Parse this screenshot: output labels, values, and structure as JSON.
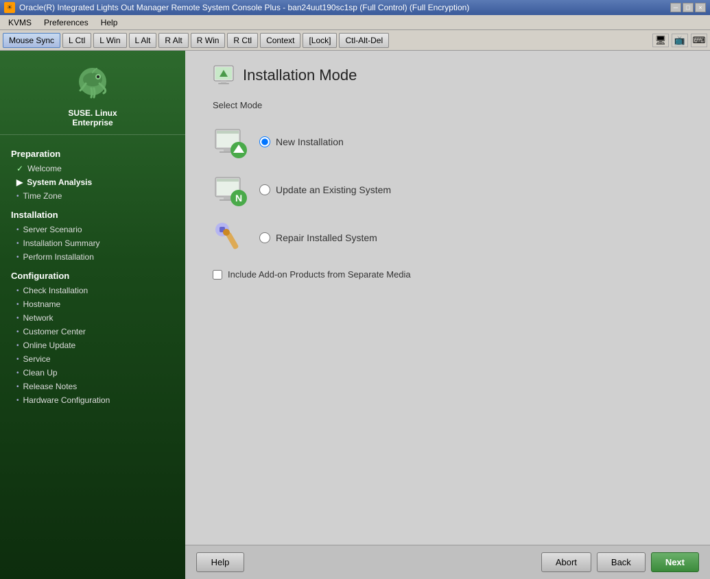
{
  "titlebar": {
    "icon": "☀",
    "title": "Oracle(R) Integrated Lights Out Manager Remote System Console Plus - ban24uut190sc1sp (Full Control) (Full Encryption)",
    "minimize": "─",
    "maximize": "□",
    "close": "×"
  },
  "menubar": {
    "items": [
      "KVMS",
      "Preferences",
      "Help"
    ]
  },
  "toolbar": {
    "buttons": [
      {
        "label": "Mouse Sync",
        "active": true
      },
      {
        "label": "L Ctl",
        "active": false
      },
      {
        "label": "L Win",
        "active": false
      },
      {
        "label": "L Alt",
        "active": false
      },
      {
        "label": "R Alt",
        "active": false
      },
      {
        "label": "R Win",
        "active": false
      },
      {
        "label": "R Ctl",
        "active": false
      },
      {
        "label": "Context",
        "active": false
      },
      {
        "label": "[Lock]",
        "active": false
      },
      {
        "label": "Ctl-Alt-Del",
        "active": false
      }
    ]
  },
  "sidebar": {
    "logo_text": "SUSE. Linux\nEnterprise",
    "sections": [
      {
        "title": "Preparation",
        "items": [
          {
            "label": "Welcome",
            "icon": "check",
            "type": "done"
          },
          {
            "label": "System Analysis",
            "icon": "arrow",
            "type": "current"
          },
          {
            "label": "Time Zone",
            "icon": "bullet",
            "type": "pending"
          }
        ]
      },
      {
        "title": "Installation",
        "items": [
          {
            "label": "Server Scenario",
            "icon": "bullet",
            "type": "pending"
          },
          {
            "label": "Installation Summary",
            "icon": "bullet",
            "type": "pending"
          },
          {
            "label": "Perform Installation",
            "icon": "bullet",
            "type": "pending"
          }
        ]
      },
      {
        "title": "Configuration",
        "items": [
          {
            "label": "Check Installation",
            "icon": "bullet",
            "type": "pending"
          },
          {
            "label": "Hostname",
            "icon": "bullet",
            "type": "pending"
          },
          {
            "label": "Network",
            "icon": "bullet",
            "type": "pending"
          },
          {
            "label": "Customer Center",
            "icon": "bullet",
            "type": "pending"
          },
          {
            "label": "Online Update",
            "icon": "bullet",
            "type": "pending"
          },
          {
            "label": "Service",
            "icon": "bullet",
            "type": "pending"
          },
          {
            "label": "Clean Up",
            "icon": "bullet",
            "type": "pending"
          },
          {
            "label": "Release Notes",
            "icon": "bullet",
            "type": "pending"
          },
          {
            "label": "Hardware Configuration",
            "icon": "bullet",
            "type": "pending"
          }
        ]
      }
    ]
  },
  "page": {
    "title": "Installation Mode",
    "select_mode_label": "Select Mode",
    "modes": [
      {
        "id": "new",
        "label": "New Installation",
        "checked": true
      },
      {
        "id": "update",
        "label": "Update an Existing System",
        "checked": false
      },
      {
        "id": "repair",
        "label": "Repair Installed System",
        "checked": false
      }
    ],
    "addon_label": "Include Add-on Products from Separate Media"
  },
  "bottom_buttons": {
    "help": "Help",
    "abort": "Abort",
    "back": "Back",
    "next": "Next"
  }
}
